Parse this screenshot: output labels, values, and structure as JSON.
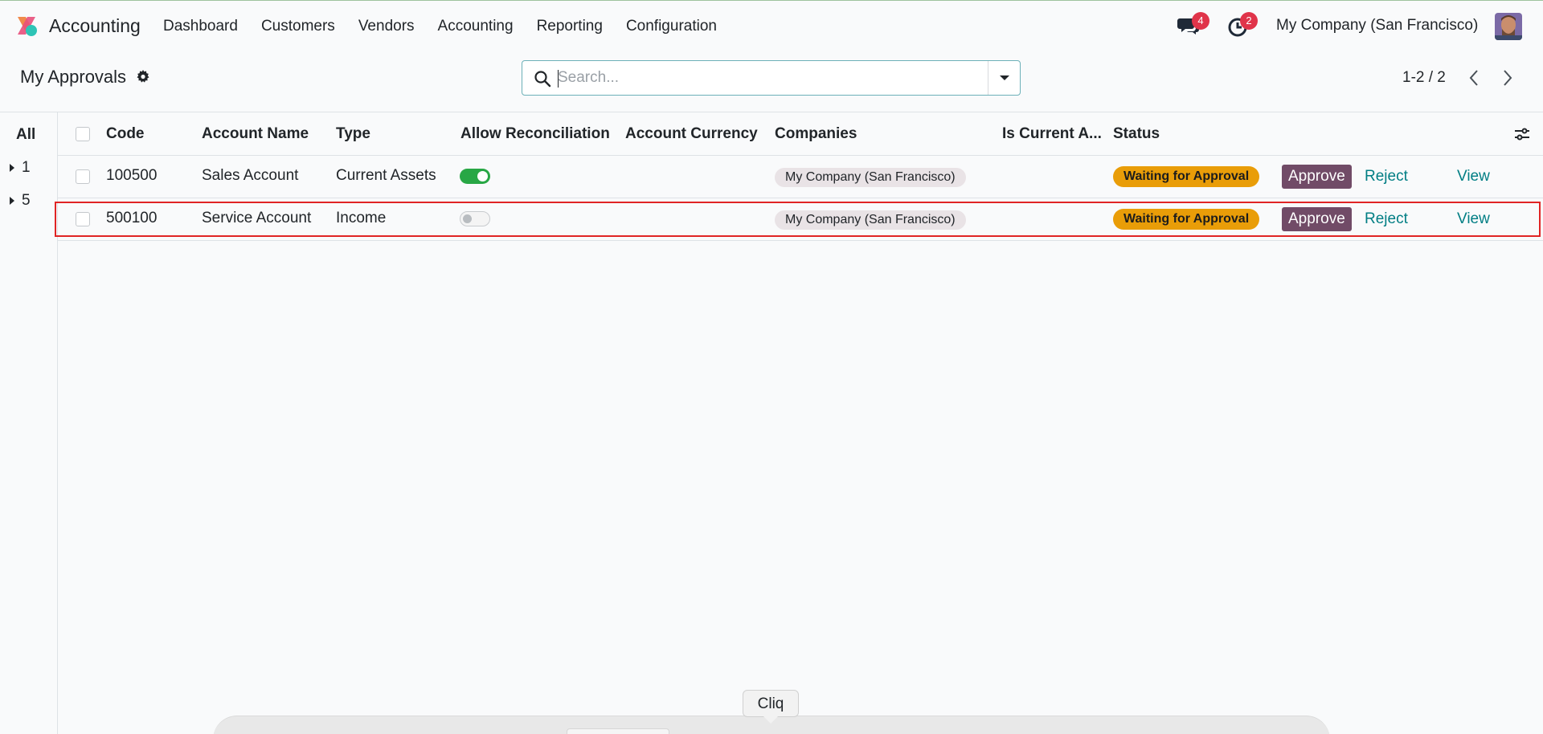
{
  "app": {
    "name": "Accounting",
    "menu": [
      "Dashboard",
      "Customers",
      "Vendors",
      "Accounting",
      "Reporting",
      "Configuration"
    ],
    "chat_count": "4",
    "activity_count": "2",
    "company": "My Company (San Francisco)"
  },
  "control_panel": {
    "title": "My Approvals",
    "search_placeholder": "Search...",
    "search_value": "",
    "pager": "1-2 / 2"
  },
  "side_panel": {
    "all_label": "All",
    "groups": [
      "1",
      "5"
    ]
  },
  "list": {
    "columns": [
      "Code",
      "Account Name",
      "Type",
      "Allow Reconciliation",
      "Account Currency",
      "Companies",
      "Is Current A...",
      "Status"
    ],
    "rows": [
      {
        "code": "100500",
        "account_name": "Sales Account",
        "type": "Current Assets",
        "allow_reconciliation": true,
        "account_currency": "",
        "company": "My Company (San Francisco)",
        "is_current": "",
        "status": "Waiting for Approval",
        "approve_label": "Approve",
        "reject_label": "Reject",
        "view_label": "View"
      },
      {
        "code": "500100",
        "account_name": "Service Account",
        "type": "Income",
        "allow_reconciliation": false,
        "account_currency": "",
        "company": "My Company (San Francisco)",
        "is_current": "",
        "status": "Waiting for Approval",
        "approve_label": "Approve",
        "reject_label": "Reject",
        "view_label": "View"
      }
    ]
  },
  "tooltip": "Cliq",
  "colors": {
    "brand": "#714b67",
    "link": "#017e84",
    "status": "#e99d08",
    "badge": "#e0344a",
    "toggle_on": "#28a745",
    "highlight": "#e02424"
  }
}
